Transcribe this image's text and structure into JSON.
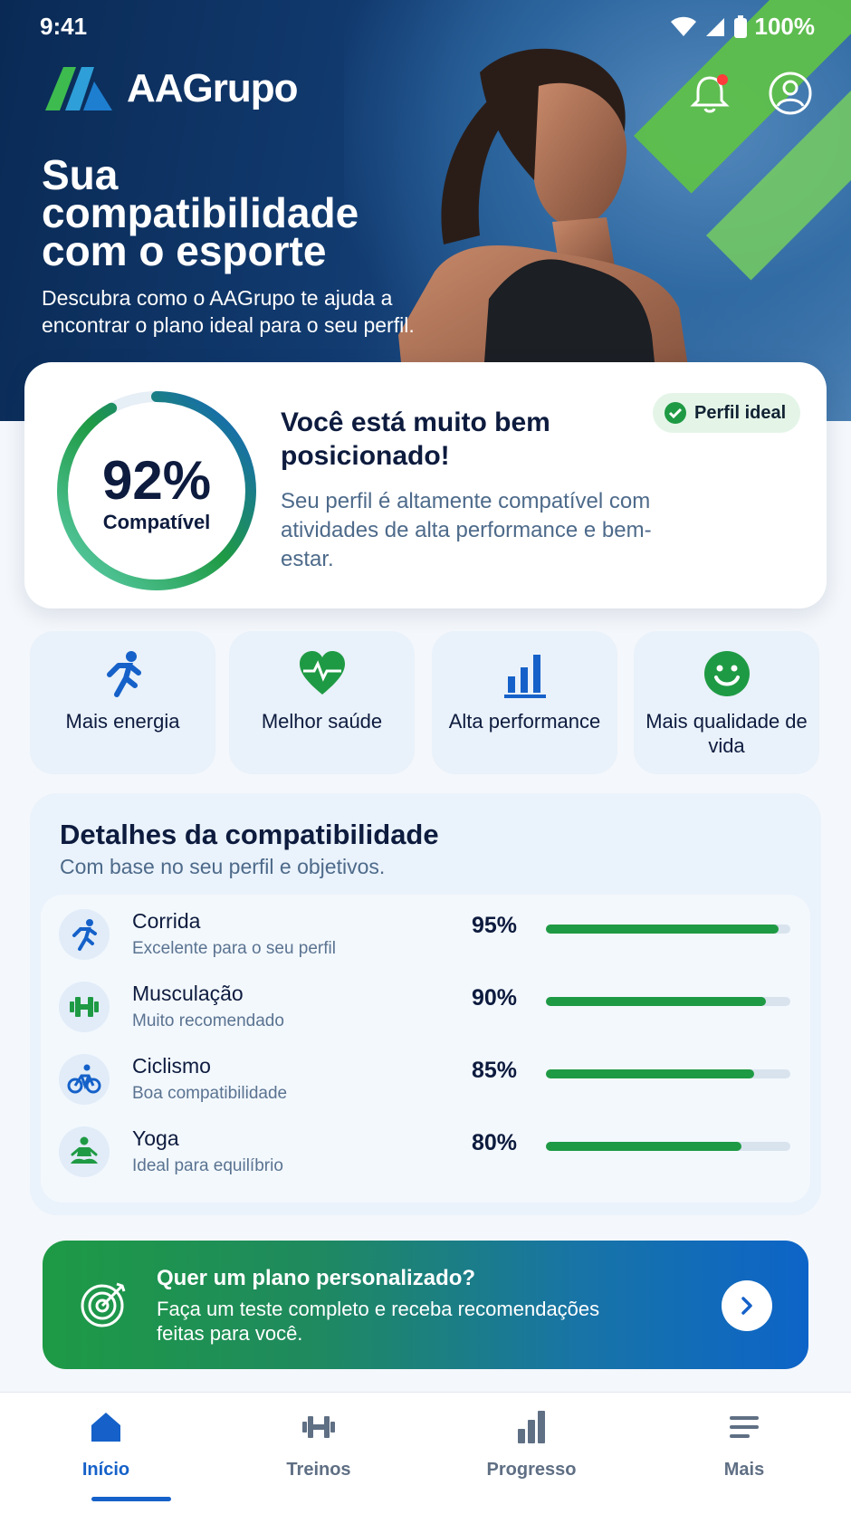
{
  "status": {
    "time": "9:41",
    "battery": "100%"
  },
  "brand": {
    "name": "AAGrupo"
  },
  "hero": {
    "title": "Sua compatibilidade com o esporte",
    "subtitle": "Descubra como o AAGrupo te ajuda a encontrar o plano ideal para o seu perfil."
  },
  "score": {
    "value": "92%",
    "percent": 92,
    "label": "Compatível",
    "title": "Você está muito bem posicionado!",
    "description": "Seu perfil é altamente compatível com atividades de alta performance e bem-estar.",
    "badge": "Perfil ideal"
  },
  "benefits": [
    {
      "label": "Mais energia",
      "icon": "running-icon"
    },
    {
      "label": "Melhor saúde",
      "icon": "heart-pulse-icon"
    },
    {
      "label": "Alta performance",
      "icon": "bar-chart-icon"
    },
    {
      "label": "Mais qualidade de vida",
      "icon": "smile-icon"
    }
  ],
  "details": {
    "title": "Detalhes da compatibilidade",
    "subtitle": "Com base no seu perfil e objetivos.",
    "rows": [
      {
        "name": "Corrida",
        "desc": "Excelente para o seu perfil",
        "pct": "95%",
        "value": 95,
        "icon": "running-icon"
      },
      {
        "name": "Musculação",
        "desc": "Muito recomendado",
        "pct": "90%",
        "value": 90,
        "icon": "dumbbell-icon"
      },
      {
        "name": "Ciclismo",
        "desc": "Boa compatibilidade",
        "pct": "85%",
        "value": 85,
        "icon": "bike-icon"
      },
      {
        "name": "Yoga",
        "desc": "Ideal para equilíbrio",
        "pct": "80%",
        "value": 80,
        "icon": "yoga-icon"
      }
    ]
  },
  "cta": {
    "title": "Quer um plano personalizado?",
    "text": "Faça um teste completo e receba recomendações feitas para você."
  },
  "nav": [
    {
      "label": "Início",
      "icon": "home-icon"
    },
    {
      "label": "Treinos",
      "icon": "dumbbell-icon"
    },
    {
      "label": "Progresso",
      "icon": "bar-chart-icon"
    },
    {
      "label": "Mais",
      "icon": "menu-icon"
    }
  ],
  "colors": {
    "primary": "#1561c9",
    "green": "#1f9a44",
    "navy": "#0d1b3e"
  }
}
